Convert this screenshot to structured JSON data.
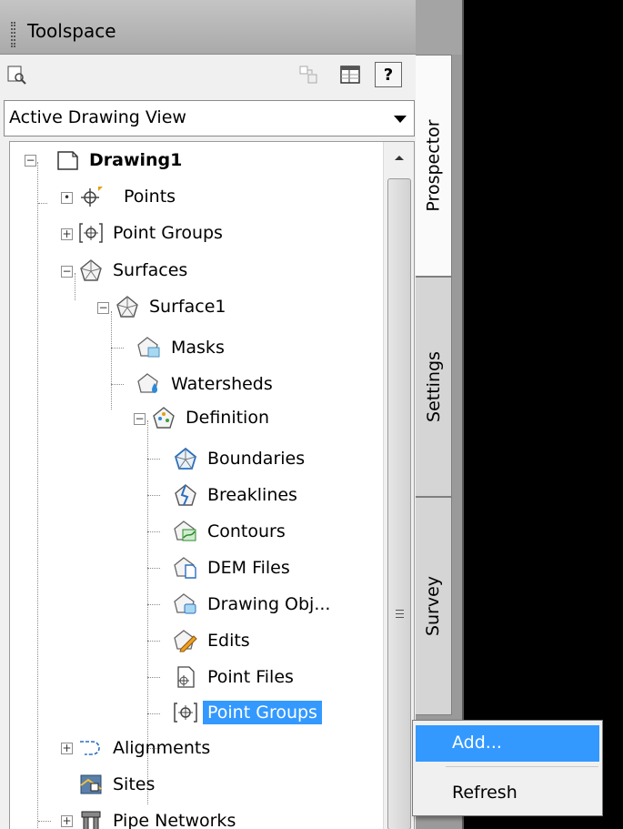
{
  "window": {
    "title": "Toolspace"
  },
  "toolbar": {
    "icons": [
      "zoom-extents-icon",
      "copy-icon",
      "panel-icon",
      "help-icon"
    ],
    "help_label": "?"
  },
  "view_select": {
    "value": "Active Drawing View"
  },
  "tree": {
    "root": {
      "label": "Drawing1",
      "expanded": true
    },
    "items": {
      "points": "Points",
      "point_groups": "Point Groups",
      "surfaces": "Surfaces",
      "surface1": "Surface1",
      "masks": "Masks",
      "watersheds": "Watersheds",
      "definition": "Definition",
      "boundaries": "Boundaries",
      "breaklines": "Breaklines",
      "contours": "Contours",
      "dem_files": "DEM Files",
      "drawing_objects": "Drawing Obj...",
      "edits": "Edits",
      "point_files": "Point Files",
      "def_point_groups": "Point Groups",
      "alignments": "Alignments",
      "sites": "Sites",
      "pipe_networks": "Pipe Networks"
    },
    "selected": "Point Groups"
  },
  "tabs": [
    "Prospector",
    "Settings",
    "Survey"
  ],
  "active_tab": "Prospector",
  "context_menu": {
    "items": [
      "Add...",
      "Refresh"
    ],
    "highlighted": "Add..."
  },
  "colors": {
    "selection": "#3399ff",
    "panel": "#f0f0f0",
    "viewport": "#000000"
  }
}
